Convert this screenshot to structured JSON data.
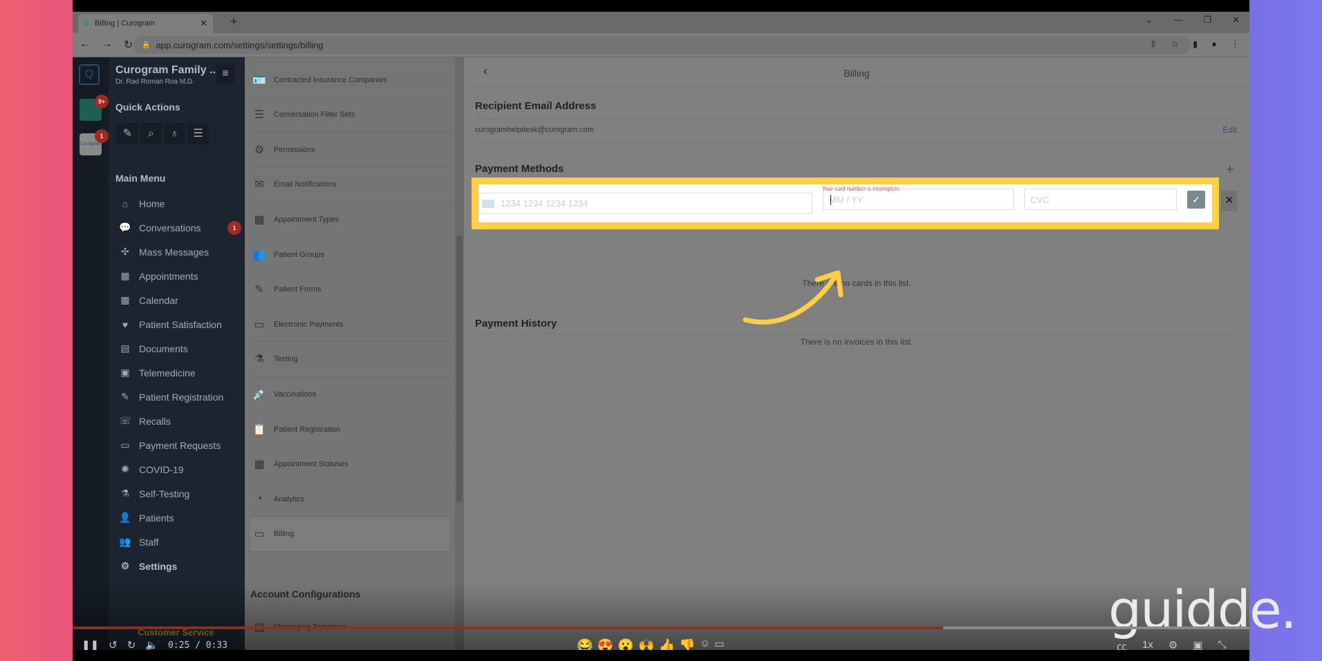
{
  "browser": {
    "tab_title": "Billing | Curogram",
    "url": "app.curogram.com/settings/settings/billing"
  },
  "sidebar": {
    "org": "Curogram Family ...",
    "doctor": "Dr. Rad Roman Roa M.D.",
    "quick_actions": "Quick Actions",
    "main_menu": "Main Menu",
    "rail_badges": [
      "9+",
      "1"
    ],
    "rail_app_label": "Curogram",
    "items": [
      {
        "label": "Home",
        "icon": "⌂"
      },
      {
        "label": "Conversations",
        "icon": "💬",
        "badge": "1"
      },
      {
        "label": "Mass Messages",
        "icon": "✣"
      },
      {
        "label": "Appointments",
        "icon": "▦"
      },
      {
        "label": "Calendar",
        "icon": "▦"
      },
      {
        "label": "Patient Satisfaction",
        "icon": "♥"
      },
      {
        "label": "Documents",
        "icon": "▤"
      },
      {
        "label": "Telemedicine",
        "icon": "▣"
      },
      {
        "label": "Patient Registration",
        "icon": "✎"
      },
      {
        "label": "Recalls",
        "icon": "☏"
      },
      {
        "label": "Payment Requests",
        "icon": "▭"
      },
      {
        "label": "COVID-19",
        "icon": "✺"
      },
      {
        "label": "Self-Testing",
        "icon": "⚗"
      },
      {
        "label": "Patients",
        "icon": "👤"
      },
      {
        "label": "Staff",
        "icon": "👥"
      },
      {
        "label": "Settings",
        "icon": "⚙",
        "active": true
      }
    ]
  },
  "settings_list": {
    "items": [
      {
        "label": "Contracted Insurance Companies",
        "icon": "🪪"
      },
      {
        "label": "Conversation Filter Sets",
        "icon": "☰"
      },
      {
        "label": "Permissions",
        "icon": "⚙"
      },
      {
        "label": "Email Notifications",
        "icon": "✉"
      },
      {
        "label": "Appointment Types",
        "icon": "▦"
      },
      {
        "label": "Patient Groups",
        "icon": "👥"
      },
      {
        "label": "Patient Forms",
        "icon": "✎"
      },
      {
        "label": "Electronic Payments",
        "icon": "▭"
      },
      {
        "label": "Testing",
        "icon": "⚗"
      },
      {
        "label": "Vaccinations",
        "icon": "💉"
      },
      {
        "label": "Patient Registration",
        "icon": "📋"
      },
      {
        "label": "Appointment Statuses",
        "icon": "▦"
      },
      {
        "label": "Analytics",
        "icon": "◔"
      },
      {
        "label": "Billing",
        "icon": "▭",
        "active": true
      }
    ],
    "account_heading": "Account Configurations",
    "next_item": "Messaging Templates"
  },
  "main": {
    "title": "Billing",
    "recipient_heading": "Recipient Email Address",
    "email": "curogramhelpdesk@curogram.com",
    "edit": "Edit",
    "payment_methods": "Payment Methods",
    "card_error": "Your card number is incomplete.",
    "card_placeholder": "1234 1234 1234 1234",
    "expiry_placeholder": "MM / YY",
    "cvc_placeholder": "CVC",
    "no_cards": "There are no cards in this list.",
    "payment_history": "Payment History",
    "no_invoices": "There is no invoices in this list."
  },
  "video": {
    "chapter": "Customer Service",
    "time": "0:25 / 0:33",
    "progress": 0.74,
    "speed": "1x",
    "brand": "guidde."
  },
  "colors": {
    "highlight": "#ffd045",
    "progress": "#8b2f22",
    "badge": "#a02a25"
  }
}
